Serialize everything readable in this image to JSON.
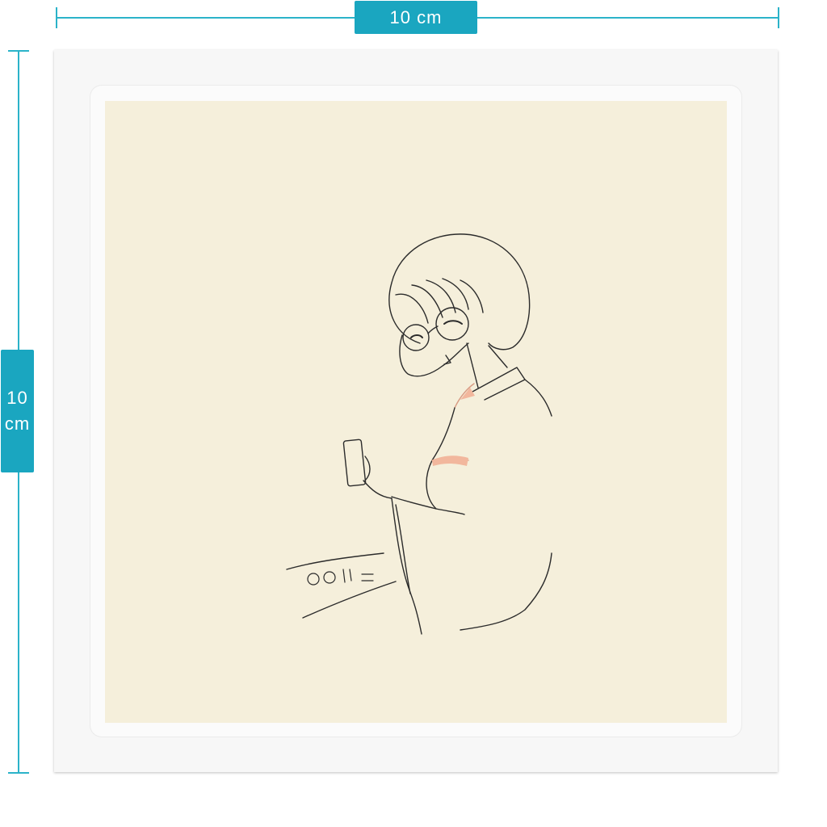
{
  "dimensions": {
    "width_label": "10 cm",
    "height_value": "10",
    "height_unit": "cm"
  },
  "colors": {
    "accent": "#1aa6c0",
    "art_background": "#f5efdb",
    "line": "#2b2b2b",
    "blush": "#f2b79d"
  },
  "artwork": {
    "subject_icon": "girl-with-glasses-holding-phone",
    "signature_text": "ooだう"
  }
}
